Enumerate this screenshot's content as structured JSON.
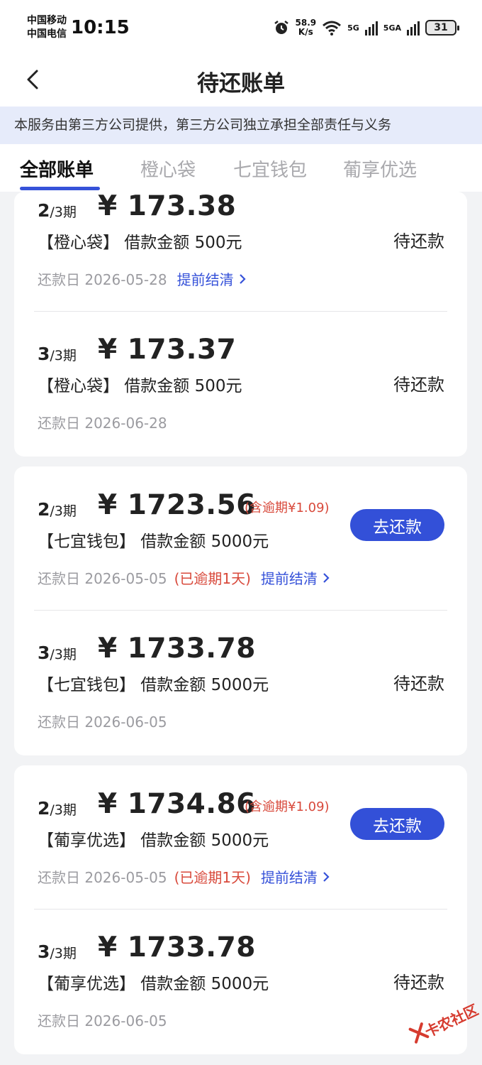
{
  "status_bar": {
    "carrier_1": "中国移动",
    "carrier_2": "中国电信",
    "time": "10:15",
    "speed_value": "58.9",
    "speed_unit": "K/s",
    "net_1": "5G",
    "net_2": "5GA",
    "battery": "31"
  },
  "header": {
    "title": "待还账单"
  },
  "notice": "本服务由第三方公司提供，第三方公司独立承担全部责任与义务",
  "tabs": [
    "全部账单",
    "橙心袋",
    "七宜钱包",
    "葡享优选"
  ],
  "labels": {
    "period_total": "/3期",
    "currency": "¥",
    "due_prefix": "还款日",
    "early_settle": "提前结清",
    "pending": "待还款",
    "repay": "去还款"
  },
  "bills": [
    {
      "period": "2",
      "amount": "173.38",
      "loan": "【橙心袋】 借款金额 500元",
      "due": "2026-05-28",
      "status": "待还款"
    },
    {
      "period": "3",
      "amount": "173.37",
      "loan": "【橙心袋】 借款金额 500元",
      "due": "2026-06-28",
      "status": "待还款"
    },
    {
      "period": "2",
      "amount": "1723.56",
      "overdue_note": "(含逾期¥1.09)",
      "loan": "【七宜钱包】 借款金额 5000元",
      "due": "2026-05-05",
      "overdue_days": "(已逾期1天)",
      "action": "去还款"
    },
    {
      "period": "3",
      "amount": "1733.78",
      "loan": "【七宜钱包】 借款金额 5000元",
      "due": "2026-06-05",
      "status": "待还款"
    },
    {
      "period": "2",
      "amount": "1734.86",
      "overdue_note": "(含逾期¥1.09)",
      "loan": "【葡享优选】 借款金额 5000元",
      "due": "2026-05-05",
      "overdue_days": "(已逾期1天)",
      "action": "去还款"
    },
    {
      "period": "3",
      "amount": "1733.78",
      "loan": "【葡享优选】 借款金额 5000元",
      "due": "2026-06-05",
      "status": "待还款"
    }
  ],
  "watermark": "卡农社区",
  "colors": {
    "accent": "#3350d8",
    "overdue": "#d8493b",
    "notice_bg": "#e6ebfa",
    "page_bg": "#f2f3f5"
  }
}
